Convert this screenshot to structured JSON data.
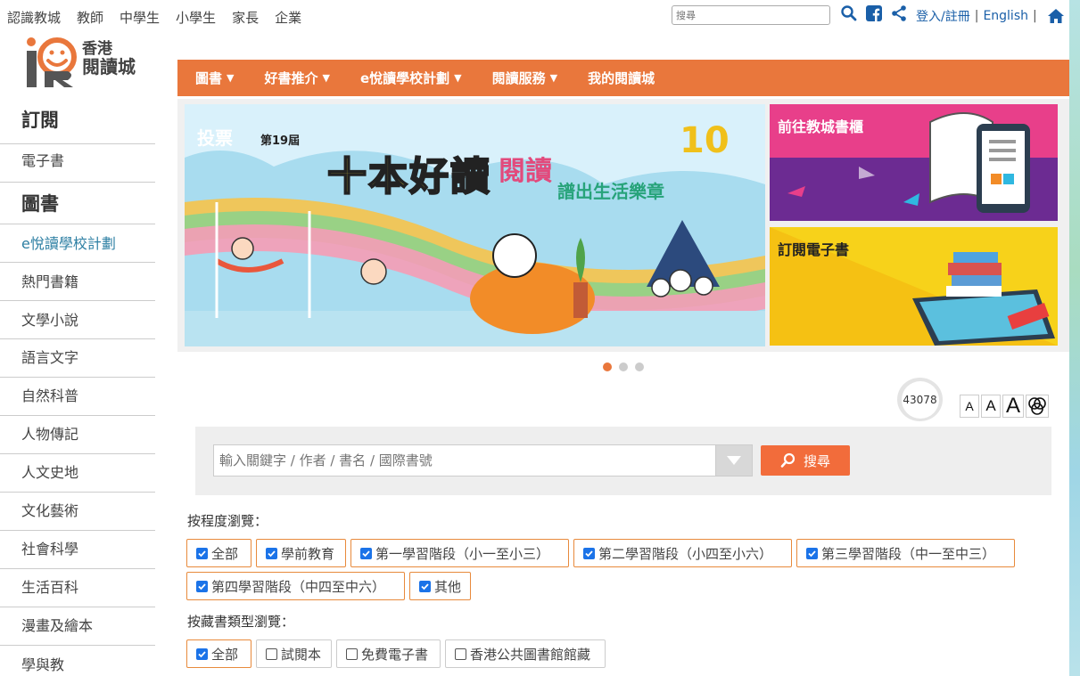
{
  "topbar": {
    "audience": [
      "認識教城",
      "教師",
      "中學生",
      "小學生",
      "家長",
      "企業"
    ],
    "search_placeholder": "搜尋",
    "login": "登入/註冊",
    "sep": "|",
    "english": "English"
  },
  "logo": {
    "line1": "香港",
    "line2": "閱讀城"
  },
  "sidebar": {
    "items": [
      {
        "label": "訂閱",
        "type": "head"
      },
      {
        "label": "電子書",
        "type": "item"
      },
      {
        "label": "圖書",
        "type": "head"
      },
      {
        "label": "e悅讀學校計劃",
        "type": "accent"
      },
      {
        "label": "熱門書籍",
        "type": "item"
      },
      {
        "label": "文學小說",
        "type": "item"
      },
      {
        "label": "語言文字",
        "type": "item"
      },
      {
        "label": "自然科普",
        "type": "item"
      },
      {
        "label": "人物傳記",
        "type": "item"
      },
      {
        "label": "人文史地",
        "type": "item"
      },
      {
        "label": "文化藝術",
        "type": "item"
      },
      {
        "label": "社會科學",
        "type": "item"
      },
      {
        "label": "生活百科",
        "type": "item"
      },
      {
        "label": "漫畫及繪本",
        "type": "item"
      },
      {
        "label": "學與教",
        "type": "item"
      }
    ]
  },
  "nav": {
    "items": [
      {
        "label": "圖書",
        "has_caret": true
      },
      {
        "label": "好書推介",
        "has_caret": true
      },
      {
        "label": "e悅讀學校計劃",
        "has_caret": true
      },
      {
        "label": "閱讀服務",
        "has_caret": true
      },
      {
        "label": "我的閱讀城",
        "has_caret": false
      }
    ],
    "caret": "▼"
  },
  "banner": {
    "vote": "投票",
    "edition": "第19屆",
    "title": "十本好讀",
    "sub1": "閱讀",
    "sub2": "譜出生活樂章",
    "badge": "10"
  },
  "promos": {
    "promo1": "前往教城書櫃",
    "promo2": "訂閱電子書"
  },
  "counter": {
    "value": "43078"
  },
  "font_buttons": [
    "A",
    "A",
    "A"
  ],
  "search": {
    "placeholder": "輸入關鍵字 / 作者 / 書名 / 國際書號",
    "button": "搜尋"
  },
  "filters": {
    "level_label": "按程度瀏覽：",
    "levels": [
      {
        "label": "全部",
        "checked": true
      },
      {
        "label": "學前教育",
        "checked": true
      },
      {
        "label": "第一學習階段（小一至小三）",
        "checked": true
      },
      {
        "label": "第二學習階段（小四至小六）",
        "checked": true
      },
      {
        "label": "第三學習階段（中一至中三）",
        "checked": true
      },
      {
        "label": "第四學習階段（中四至中六）",
        "checked": true
      },
      {
        "label": "其他",
        "checked": true
      }
    ],
    "type_label": "按藏書類型瀏覽：",
    "types": [
      {
        "label": "全部",
        "checked": true
      },
      {
        "label": "試閱本",
        "checked": false
      },
      {
        "label": "免費電子書",
        "checked": false
      },
      {
        "label": "香港公共圖書館館藏",
        "checked": false
      }
    ]
  },
  "colors": {
    "nav_orange": "#e9773c",
    "search_button": "#f26c3b",
    "link_blue": "#1a5fa8",
    "accent_teal": "#2d7fa3"
  }
}
